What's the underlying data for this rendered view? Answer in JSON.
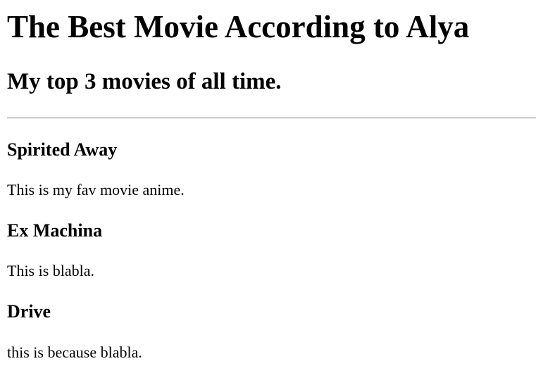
{
  "heading": "The Best Movie According to Alya",
  "subheading": "My top 3 movies of all time.",
  "movies": [
    {
      "title": "Spirited Away",
      "description": "This is my fav movie anime."
    },
    {
      "title": "Ex Machina",
      "description": "This is blabla."
    },
    {
      "title": "Drive",
      "description": "this is because blabla."
    }
  ]
}
